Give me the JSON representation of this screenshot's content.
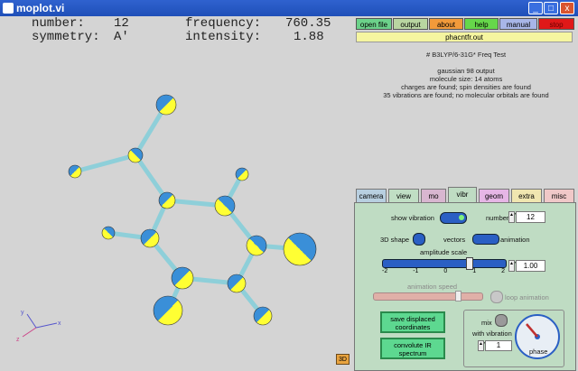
{
  "window": {
    "title": "moplot.vi",
    "min": "_",
    "max": "□",
    "close": "x"
  },
  "readout": {
    "number_label": "number:",
    "number_value": "12",
    "symmetry_label": "symmetry:",
    "symmetry_value": "A'",
    "frequency_label": "frequency:",
    "frequency_value": "760.35",
    "intensity_label": "intensity:",
    "intensity_value": "1.88"
  },
  "toolbar": {
    "open": "open file",
    "output": "output",
    "about": "about",
    "help": "help",
    "manual": "manual",
    "stop": "stop"
  },
  "file_name": "phacntfr.out",
  "info": {
    "line1": "# B3LYP/6-31G* Freq Test",
    "line2": "gaussian 98 output",
    "line3": "molecule size: 14 atoms",
    "line4": "charges are found; spin densities are found",
    "line5": "35 vibrations are found; no molecular orbitals are found"
  },
  "tabs": [
    "camera",
    "view",
    "mo",
    "vibr",
    "geom",
    "extra",
    "misc"
  ],
  "vibr": {
    "show_vibration": "show vibration",
    "number_label": "number",
    "number_value": "12",
    "shape_3d": "3D shape",
    "vectors": "vectors",
    "animation": "animation",
    "amplitude_scale": "amplitude scale",
    "amplitude_value": "1.00",
    "amplitude_fraction": 0.72,
    "ticks": [
      "-2",
      "-1",
      "0",
      "1",
      "2"
    ],
    "animation_speed": "animation speed",
    "loop_animation": "loop animation",
    "save_button": "save displaced coordinates",
    "convolute_button": "convolute IR spectrum",
    "mix": "mix",
    "with_vibration": "with vibration",
    "mix_value": "1",
    "phase": "phase"
  },
  "badge_3d": "3D",
  "colors": {
    "accent": "#2a5fc4",
    "yellow": "#ffff33",
    "blue": "#3a8fd8",
    "bond": "#b8e6ec"
  }
}
